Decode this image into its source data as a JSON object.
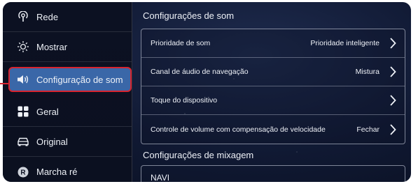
{
  "sidebar": {
    "items": [
      {
        "label": "Rede",
        "icon": "antenna-icon"
      },
      {
        "label": "Mostrar",
        "icon": "sun-icon"
      },
      {
        "label": "Configuração de som",
        "icon": "speaker-icon",
        "active": true
      },
      {
        "label": "Geral",
        "icon": "grid-icon"
      },
      {
        "label": "Original",
        "icon": "car-icon"
      },
      {
        "label": "Marcha ré",
        "icon": "reverse-r-icon",
        "badge": "R"
      }
    ]
  },
  "main": {
    "sound_title": "Configurações de som",
    "rows": [
      {
        "label": "Prioridade de som",
        "value": "Prioridade inteligente"
      },
      {
        "label": "Canal de áudio de navegação",
        "value": "Mistura"
      },
      {
        "label": "Toque do dispositivo",
        "value": ""
      },
      {
        "label": "Controle de volume com compensação de velocidade",
        "value": "Fechar"
      }
    ],
    "mix_title": "Configurações de mixagem",
    "mix_first_item": "NAVI"
  },
  "colors": {
    "highlight": "#d8242f",
    "active_bg": "#3a67a8",
    "background": "#101933"
  }
}
